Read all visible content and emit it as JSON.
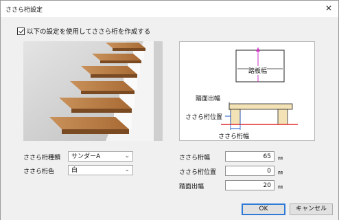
{
  "window": {
    "title": "ささら桁設定",
    "close_glyph": "✕"
  },
  "checkbox": {
    "label": "以下の設定を使用してささら桁を作成する",
    "checked": true
  },
  "diagram": {
    "label_step_width": "踏板幅",
    "label_tread_overhang": "踏面出幅",
    "label_stringer_position": "ささら桁位置",
    "label_stringer_width": "ささら桁幅"
  },
  "left_form": {
    "type_label": "ささら桁種類",
    "type_value": "サンダーA",
    "color_label": "ささら桁色",
    "color_value": "白"
  },
  "right_form": {
    "width_label": "ささら桁幅",
    "width_value": "65",
    "position_label": "ささら桁位置",
    "position_value": "0",
    "overhang_label": "踏面出幅",
    "overhang_value": "20",
    "unit": "㎜"
  },
  "buttons": {
    "ok": "OK",
    "cancel": "キャンセル"
  }
}
